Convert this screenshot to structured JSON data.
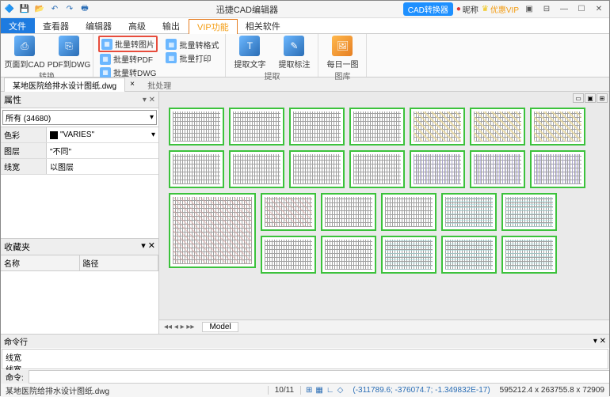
{
  "title": "迅捷CAD编辑器",
  "qat": [
    "💾",
    "📂",
    "↶",
    "↷",
    "🖶"
  ],
  "header_right": {
    "converter": "CAD转换器",
    "nickname": "昵称",
    "vip": "优惠VIP"
  },
  "menu": {
    "file": "文件",
    "view": "查看器",
    "editor": "编辑器",
    "advanced": "高级",
    "output": "输出",
    "vip": "VIP功能",
    "related": "相关软件"
  },
  "ribbon": {
    "group_convert": "转换",
    "page_to_cad": "页面到CAD",
    "pdf_to_dwg": "PDF到DWG",
    "group_batch": "批处理",
    "batch_img": "批量转图片",
    "batch_pdf": "批量转PDF",
    "batch_dwg": "批量转DWG",
    "batch_fmt": "批量转格式",
    "batch_print": "批量打印",
    "group_extract": "提取",
    "extract_text": "提取文字",
    "extract_annot": "提取标注",
    "group_gallery": "图库",
    "daily": "每日一图"
  },
  "doc": {
    "name": "某地医院给排水设计图纸.dwg",
    "close": "×"
  },
  "props": {
    "title": "属性",
    "selector": "所有 (34680)",
    "rows": [
      {
        "k": "色彩",
        "v": "\"VARIES\""
      },
      {
        "k": "图层",
        "v": "\"不同\""
      },
      {
        "k": "线宽",
        "v": "以图层"
      }
    ]
  },
  "fav": {
    "title": "收藏夹",
    "col1": "名称",
    "col2": "路径"
  },
  "model_tab": "Model",
  "cmd": {
    "title": "命令行",
    "history": "线宽\n线宽",
    "label": "命令:"
  },
  "status": {
    "file": "某地医院给排水设计图纸.dwg",
    "page": "10/11",
    "coord": "(-311789.6; -376074.7; -1.349832E-17)",
    "dim": "595212.4 x 263755.8 x 72909"
  }
}
